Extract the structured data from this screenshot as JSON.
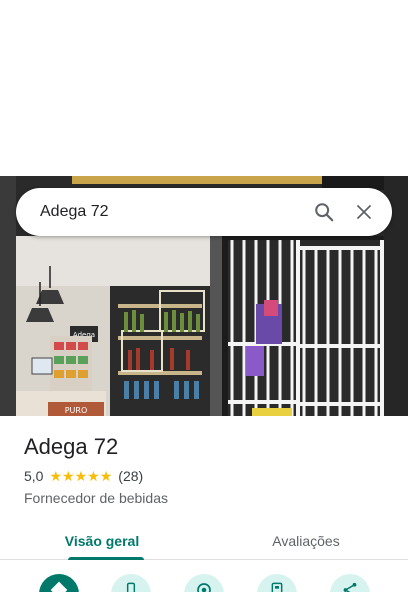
{
  "search": {
    "query": "Adega 72",
    "search_icon": "search-icon",
    "close_icon": "close-icon"
  },
  "place": {
    "name": "Adega 72",
    "rating": "5,0",
    "stars": 5,
    "review_count": "(28)",
    "category": "Fornecedor de bebidas"
  },
  "tabs": [
    {
      "label": "Visão geral",
      "active": true
    },
    {
      "label": "Avaliações",
      "active": false
    }
  ],
  "actions": [
    {
      "icon": "directions-icon",
      "primary": true
    },
    {
      "icon": "phone-icon",
      "primary": false
    },
    {
      "icon": "website-icon",
      "primary": false
    },
    {
      "icon": "save-icon",
      "primary": false
    },
    {
      "icon": "share-icon",
      "primary": false
    }
  ],
  "colors": {
    "accent": "#00796b",
    "star": "#fbbc04",
    "action_secondary_bg": "#d6f3ef"
  },
  "photo": {
    "sign_text": "Adega",
    "counter_text": "PURO"
  }
}
